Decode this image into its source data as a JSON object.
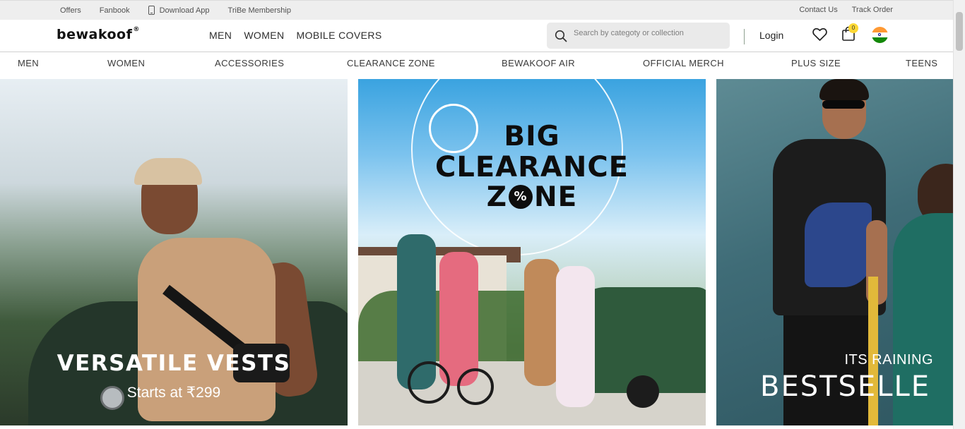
{
  "topbar": {
    "links_left": [
      "Offers",
      "Fanbook",
      "Download App",
      "TriBe Membership"
    ],
    "links_right": [
      "Contact Us",
      "Track Order"
    ]
  },
  "header": {
    "logo": "Bewakoof",
    "logo_mark": "®",
    "nav": [
      "MEN",
      "WOMEN",
      "MOBILE COVERS"
    ],
    "search_placeholder": "Search by categoty or collection",
    "login": "Login",
    "cart_count": "0",
    "country_flag": "india-flag-icon"
  },
  "category_nav": [
    "MEN",
    "WOMEN",
    "ACCESSORIES",
    "CLEARANCE ZONE",
    "BEWAKOOF AIR",
    "OFFICIAL MERCH",
    "PLUS SIZE",
    "TEENS"
  ],
  "banners": [
    {
      "title": "VERSATILE VESTS",
      "subtitle": "Starts at ₹299"
    },
    {
      "line1": "BIG",
      "line2": "CLEARANCE",
      "line3": "ZONE",
      "percent_symbol": "%"
    },
    {
      "kicker": "ITS RAINING",
      "title": "BESTSELLE"
    }
  ],
  "colors": {
    "accent_yellow": "#fdd835",
    "topbar_bg": "#eeeeee",
    "search_bg": "#eaeaea"
  }
}
